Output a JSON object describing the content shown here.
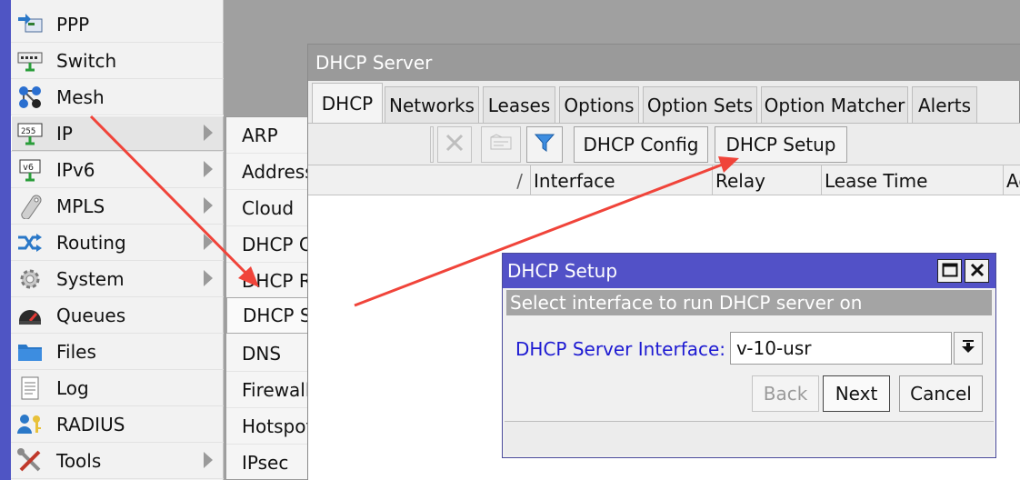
{
  "main_menu": {
    "items": [
      {
        "label": "PPP",
        "icon": "ppp-icon",
        "has_submenu": false
      },
      {
        "label": "Switch",
        "icon": "switch-icon",
        "has_submenu": false
      },
      {
        "label": "Mesh",
        "icon": "mesh-icon",
        "has_submenu": false
      },
      {
        "label": "IP",
        "icon": "ip-icon",
        "has_submenu": true
      },
      {
        "label": "IPv6",
        "icon": "ipv6-icon",
        "has_submenu": true
      },
      {
        "label": "MPLS",
        "icon": "mpls-icon",
        "has_submenu": true
      },
      {
        "label": "Routing",
        "icon": "routing-icon",
        "has_submenu": true
      },
      {
        "label": "System",
        "icon": "system-gear-icon",
        "has_submenu": true
      },
      {
        "label": "Queues",
        "icon": "queues-icon",
        "has_submenu": false
      },
      {
        "label": "Files",
        "icon": "folder-icon",
        "has_submenu": false
      },
      {
        "label": "Log",
        "icon": "log-icon",
        "has_submenu": false
      },
      {
        "label": "RADIUS",
        "icon": "radius-users-icon",
        "has_submenu": false
      },
      {
        "label": "Tools",
        "icon": "tools-icon",
        "has_submenu": true
      }
    ],
    "active_index": 3
  },
  "ip_submenu": {
    "items": [
      "ARP",
      "Addresses",
      "Cloud",
      "DHCP Client",
      "DHCP Relay",
      "DHCP Server",
      "DNS",
      "Firewall",
      "Hotspot",
      "IPsec"
    ],
    "selected_index": 5
  },
  "dhcp_window": {
    "title": "DHCP Server",
    "tabs": [
      "DHCP",
      "Networks",
      "Leases",
      "Options",
      "Option Sets",
      "Option Matcher",
      "Alerts"
    ],
    "active_tab": 0,
    "toolbar": {
      "dhcp_config_label": "DHCP Config",
      "dhcp_setup_label": "DHCP Setup"
    },
    "columns": [
      "/",
      "Interface",
      "Relay",
      "Lease Time",
      "Ad"
    ]
  },
  "setup_dialog": {
    "title": "DHCP Setup",
    "instruction": "Select interface to run DHCP server on",
    "interface_label": "DHCP Server Interface:",
    "interface_value": "v-10-usr",
    "back_label": "Back",
    "next_label": "Next",
    "cancel_label": "Cancel"
  },
  "colors": {
    "dialog_title": "#5251c7",
    "field_label": "#1d1ad2",
    "annotation_arrow": "#f0443a",
    "menu_strip": "#4f55c4"
  }
}
